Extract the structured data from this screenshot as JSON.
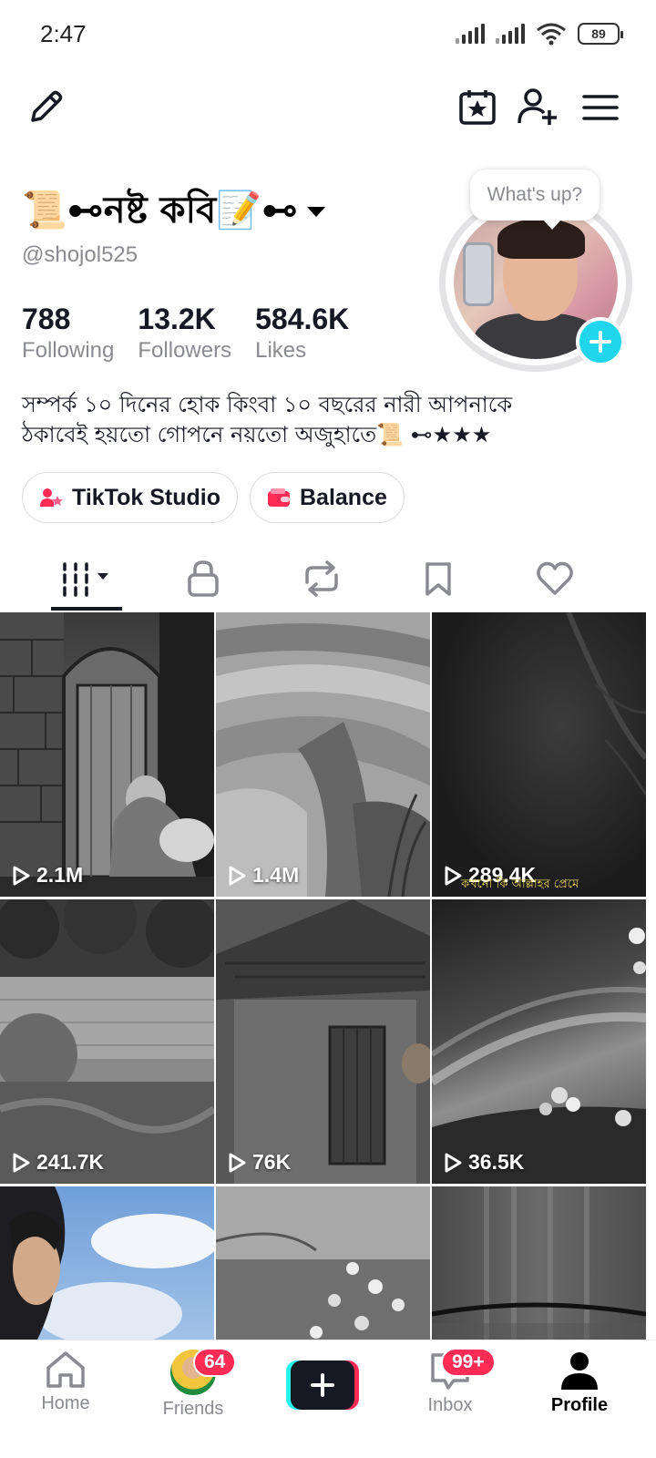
{
  "status_bar": {
    "time": "2:47",
    "battery": "89"
  },
  "topbar": {
    "edit_icon": "pencil-icon",
    "calendar_icon": "calendar-star-icon",
    "add_friend_icon": "add-user-icon",
    "menu_icon": "menu-icon"
  },
  "profile": {
    "nickname": "📜⊷নষ্ট কবি📝⊷",
    "username": "@shojol525",
    "avatar_bubble": "What's up?",
    "stats": [
      {
        "value": "788",
        "label": "Following"
      },
      {
        "value": "13.2K",
        "label": "Followers"
      },
      {
        "value": "584.6K",
        "label": "Likes"
      }
    ],
    "bio_line1": "সম্পর্ক ১০ দিনের হোক কিংবা ১০ বছরের নারী আপনাকে",
    "bio_line2": "ঠকাবেই হয়তো গোপনে নয়তো অজুহাতে📜 ⊷★★★",
    "buttons": {
      "studio": "TikTok Studio",
      "balance": "Balance"
    }
  },
  "tabs": [
    {
      "name": "videos",
      "icon": "grid-icon",
      "active": true
    },
    {
      "name": "private",
      "icon": "lock-icon"
    },
    {
      "name": "reposts",
      "icon": "repost-icon"
    },
    {
      "name": "favorites",
      "icon": "bookmark-icon"
    },
    {
      "name": "liked",
      "icon": "heart-icon"
    }
  ],
  "videos": [
    {
      "views": "2.1M"
    },
    {
      "views": "1.4M"
    },
    {
      "views": "289.4K",
      "caption": "কখনো কি আল্লাহর প্রেমে"
    },
    {
      "views": "241.7K"
    },
    {
      "views": "76K"
    },
    {
      "views": "36.5K"
    },
    {
      "views": ""
    },
    {
      "views": ""
    },
    {
      "views": ""
    }
  ],
  "bottom_nav": {
    "home": "Home",
    "friends": "Friends",
    "friends_badge": "64",
    "inbox": "Inbox",
    "inbox_badge": "99+",
    "profile": "Profile"
  },
  "colors": {
    "accent_cyan": "#20d5ec",
    "badge_red": "#fe2c55",
    "text_primary": "#161823",
    "text_secondary": "#8a8b91"
  }
}
